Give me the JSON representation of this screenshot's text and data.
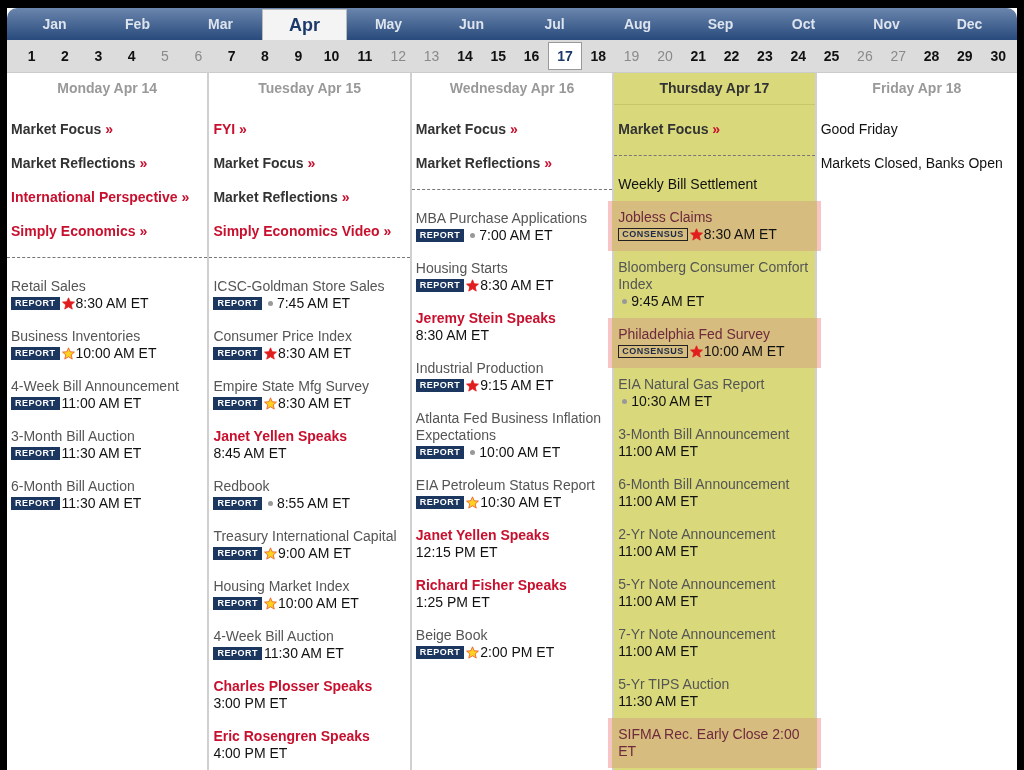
{
  "months": [
    {
      "label": "Jan",
      "selected": false
    },
    {
      "label": "Feb",
      "selected": false
    },
    {
      "label": "Mar",
      "selected": false
    },
    {
      "label": "Apr",
      "selected": true
    },
    {
      "label": "May",
      "selected": false
    },
    {
      "label": "Jun",
      "selected": false
    },
    {
      "label": "Jul",
      "selected": false
    },
    {
      "label": "Aug",
      "selected": false
    },
    {
      "label": "Sep",
      "selected": false
    },
    {
      "label": "Oct",
      "selected": false
    },
    {
      "label": "Nov",
      "selected": false
    },
    {
      "label": "Dec",
      "selected": false
    }
  ],
  "days": [
    {
      "label": "1",
      "selected": false,
      "disabled": false
    },
    {
      "label": "2",
      "selected": false,
      "disabled": false
    },
    {
      "label": "3",
      "selected": false,
      "disabled": false
    },
    {
      "label": "4",
      "selected": false,
      "disabled": false
    },
    {
      "label": "5",
      "selected": false,
      "disabled": true
    },
    {
      "label": "6",
      "selected": false,
      "disabled": true
    },
    {
      "label": "7",
      "selected": false,
      "disabled": false
    },
    {
      "label": "8",
      "selected": false,
      "disabled": false
    },
    {
      "label": "9",
      "selected": false,
      "disabled": false
    },
    {
      "label": "10",
      "selected": false,
      "disabled": false
    },
    {
      "label": "11",
      "selected": false,
      "disabled": false
    },
    {
      "label": "12",
      "selected": false,
      "disabled": true
    },
    {
      "label": "13",
      "selected": false,
      "disabled": true
    },
    {
      "label": "14",
      "selected": false,
      "disabled": false
    },
    {
      "label": "15",
      "selected": false,
      "disabled": false
    },
    {
      "label": "16",
      "selected": false,
      "disabled": false
    },
    {
      "label": "17",
      "selected": true,
      "disabled": false
    },
    {
      "label": "18",
      "selected": false,
      "disabled": false
    },
    {
      "label": "19",
      "selected": false,
      "disabled": true
    },
    {
      "label": "20",
      "selected": false,
      "disabled": true
    },
    {
      "label": "21",
      "selected": false,
      "disabled": false
    },
    {
      "label": "22",
      "selected": false,
      "disabled": false
    },
    {
      "label": "23",
      "selected": false,
      "disabled": false
    },
    {
      "label": "24",
      "selected": false,
      "disabled": false
    },
    {
      "label": "25",
      "selected": false,
      "disabled": false
    },
    {
      "label": "26",
      "selected": false,
      "disabled": true
    },
    {
      "label": "27",
      "selected": false,
      "disabled": true
    },
    {
      "label": "28",
      "selected": false,
      "disabled": false
    },
    {
      "label": "29",
      "selected": false,
      "disabled": false
    },
    {
      "label": "30",
      "selected": false,
      "disabled": false
    }
  ],
  "columns": [
    {
      "title": "Monday Apr 14",
      "selected": false,
      "links": [
        {
          "label": "Market Focus",
          "arrow": "»",
          "kind": "dark"
        },
        {
          "label": "Market Reflections",
          "arrow": "»",
          "kind": "dark"
        },
        {
          "label": "International Perspective",
          "arrow": "»",
          "kind": "red"
        },
        {
          "label": "Simply Economics",
          "arrow": "»",
          "kind": "red"
        }
      ],
      "events": [
        {
          "kind": "report",
          "title": "Retail Sales",
          "badge": {
            "text": "REPORT",
            "kind": "report"
          },
          "marker": {
            "kind": "star",
            "color": "#e21d1d"
          },
          "time": "8:30 AM ET",
          "highlight": false
        },
        {
          "kind": "report",
          "title": "Business Inventories",
          "badge": {
            "text": "REPORT",
            "kind": "report"
          },
          "marker": {
            "kind": "star",
            "color": "#ffd21f",
            "outline": true
          },
          "time": "10:00 AM ET",
          "highlight": false
        },
        {
          "kind": "report",
          "title": "4-Week Bill Announcement",
          "badge": {
            "text": "REPORT",
            "kind": "report"
          },
          "time": "11:00 AM ET",
          "highlight": false
        },
        {
          "kind": "report",
          "title": "3-Month Bill Auction",
          "badge": {
            "text": "REPORT",
            "kind": "report"
          },
          "time": "11:30 AM ET",
          "highlight": false
        },
        {
          "kind": "report",
          "title": "6-Month Bill Auction",
          "badge": {
            "text": "REPORT",
            "kind": "report"
          },
          "time": "11:30 AM ET",
          "highlight": false
        }
      ]
    },
    {
      "title": "Tuesday Apr 15",
      "selected": false,
      "links": [
        {
          "label": "FYI",
          "arrow": "»",
          "kind": "red"
        },
        {
          "label": "Market Focus",
          "arrow": "»",
          "kind": "dark"
        },
        {
          "label": "Market Reflections",
          "arrow": "»",
          "kind": "dark"
        },
        {
          "label": "Simply Economics Video",
          "arrow": "»",
          "kind": "red"
        }
      ],
      "events": [
        {
          "kind": "report",
          "title": "ICSC-Goldman Store Sales",
          "badge": {
            "text": "REPORT",
            "kind": "report"
          },
          "marker": {
            "kind": "dot",
            "color": "#999999"
          },
          "time": "7:45 AM ET",
          "highlight": false
        },
        {
          "kind": "report",
          "title": "Consumer Price Index",
          "badge": {
            "text": "REPORT",
            "kind": "report"
          },
          "marker": {
            "kind": "star",
            "color": "#e21d1d"
          },
          "time": "8:30 AM ET",
          "highlight": false
        },
        {
          "kind": "report",
          "title": "Empire State Mfg Survey",
          "badge": {
            "text": "REPORT",
            "kind": "report"
          },
          "marker": {
            "kind": "star",
            "color": "#ffd21f",
            "outline": true
          },
          "time": "8:30 AM ET",
          "highlight": false
        },
        {
          "kind": "speech",
          "title": "Janet Yellen Speaks",
          "time": "8:45 AM ET",
          "highlight": false
        },
        {
          "kind": "report",
          "title": "Redbook",
          "badge": {
            "text": "REPORT",
            "kind": "report"
          },
          "marker": {
            "kind": "dot",
            "color": "#999999"
          },
          "time": "8:55 AM ET",
          "highlight": false
        },
        {
          "kind": "report",
          "title": "Treasury International Capital",
          "badge": {
            "text": "REPORT",
            "kind": "report"
          },
          "marker": {
            "kind": "star",
            "color": "#ffd21f",
            "outline": true
          },
          "time": "9:00 AM ET",
          "highlight": false
        },
        {
          "kind": "report",
          "title": "Housing Market Index",
          "badge": {
            "text": "REPORT",
            "kind": "report"
          },
          "marker": {
            "kind": "star",
            "color": "#ffd21f",
            "outline": true
          },
          "time": "10:00 AM ET",
          "highlight": false
        },
        {
          "kind": "report",
          "title": "4-Week Bill Auction",
          "badge": {
            "text": "REPORT",
            "kind": "report"
          },
          "time": "11:30 AM ET",
          "highlight": false
        },
        {
          "kind": "speech",
          "title": "Charles Plosser Speaks",
          "time": "3:00 PM ET",
          "highlight": false
        },
        {
          "kind": "speech",
          "title": "Eric Rosengren Speaks",
          "time": "4:00 PM ET",
          "highlight": false
        }
      ]
    },
    {
      "title": "Wednesday Apr 16",
      "selected": false,
      "links": [
        {
          "label": "Market Focus",
          "arrow": "»",
          "kind": "dark"
        },
        {
          "label": "Market Reflections",
          "arrow": "»",
          "kind": "dark"
        }
      ],
      "events": [
        {
          "kind": "report",
          "title": "MBA Purchase Applications",
          "badge": {
            "text": "REPORT",
            "kind": "report"
          },
          "marker": {
            "kind": "dot",
            "color": "#999999"
          },
          "time": "7:00 AM ET",
          "highlight": false
        },
        {
          "kind": "report",
          "title": "Housing Starts",
          "badge": {
            "text": "REPORT",
            "kind": "report"
          },
          "marker": {
            "kind": "star",
            "color": "#e21d1d"
          },
          "time": "8:30 AM ET",
          "highlight": false
        },
        {
          "kind": "speech",
          "title": "Jeremy Stein Speaks",
          "time": "8:30 AM ET",
          "highlight": false
        },
        {
          "kind": "report",
          "title": "Industrial Production",
          "badge": {
            "text": "REPORT",
            "kind": "report"
          },
          "marker": {
            "kind": "star",
            "color": "#e21d1d"
          },
          "time": "9:15 AM ET",
          "highlight": false
        },
        {
          "kind": "report",
          "title": "Atlanta Fed Business Inflation Expectations",
          "badge": {
            "text": "REPORT",
            "kind": "report"
          },
          "marker": {
            "kind": "dot",
            "color": "#999999"
          },
          "time": "10:00 AM ET",
          "highlight": false
        },
        {
          "kind": "report",
          "title": "EIA Petroleum Status Report",
          "badge": {
            "text": "REPORT",
            "kind": "report"
          },
          "marker": {
            "kind": "star",
            "color": "#ffd21f",
            "outline": true
          },
          "time": "10:30 AM ET",
          "highlight": false
        },
        {
          "kind": "speech",
          "title": "Janet Yellen Speaks",
          "time": "12:15 PM ET",
          "highlight": false
        },
        {
          "kind": "speech",
          "title": "Richard Fisher Speaks",
          "time": "1:25 PM ET",
          "highlight": false
        },
        {
          "kind": "report",
          "title": "Beige Book",
          "badge": {
            "text": "REPORT",
            "kind": "report"
          },
          "marker": {
            "kind": "star",
            "color": "#ffd21f",
            "outline": true
          },
          "time": "2:00 PM ET",
          "highlight": false
        }
      ]
    },
    {
      "title": "Thursday Apr 17",
      "selected": true,
      "links": [
        {
          "label": "Market Focus",
          "arrow": "»",
          "kind": "dark"
        }
      ],
      "events": [
        {
          "kind": "plain",
          "title": "Weekly Bill Settlement",
          "highlight": false
        },
        {
          "kind": "report",
          "title": "Jobless Claims",
          "badge": {
            "text": "CONSENSUS",
            "kind": "consensus"
          },
          "marker": {
            "kind": "star",
            "color": "#e21d1d"
          },
          "time": "8:30 AM ET",
          "highlight": true
        },
        {
          "kind": "report",
          "title": "Bloomberg Consumer Comfort Index",
          "marker": {
            "kind": "dot",
            "color": "#999999"
          },
          "time": "9:45 AM ET",
          "highlight": false
        },
        {
          "kind": "report",
          "title": "Philadelphia Fed Survey",
          "badge": {
            "text": "CONSENSUS",
            "kind": "consensus"
          },
          "marker": {
            "kind": "star",
            "color": "#e21d1d"
          },
          "time": "10:00 AM ET",
          "highlight": true
        },
        {
          "kind": "report",
          "title": "EIA Natural Gas Report",
          "marker": {
            "kind": "dot",
            "color": "#999999"
          },
          "time": "10:30 AM ET",
          "highlight": false
        },
        {
          "kind": "report",
          "title": "3-Month Bill Announcement",
          "time": "11:00 AM ET",
          "highlight": false
        },
        {
          "kind": "report",
          "title": "6-Month Bill Announcement",
          "time": "11:00 AM ET",
          "highlight": false
        },
        {
          "kind": "report",
          "title": "2-Yr Note Announcement",
          "time": "11:00 AM ET",
          "highlight": false
        },
        {
          "kind": "report",
          "title": "5-Yr Note Announcement",
          "time": "11:00 AM ET",
          "highlight": false
        },
        {
          "kind": "report",
          "title": "7-Yr Note Announcement",
          "time": "11:00 AM ET",
          "highlight": false
        },
        {
          "kind": "report",
          "title": "5-Yr TIPS Auction",
          "time": "11:30 AM ET",
          "highlight": false
        },
        {
          "kind": "plain",
          "title": "SIFMA Rec. Early Close 2:00 ET",
          "highlight": true
        }
      ]
    },
    {
      "title": "Friday Apr 18",
      "selected": false,
      "links": [
        {
          "label": "Good Friday",
          "kind": "plain"
        },
        {
          "label": "Markets Closed, Banks Open",
          "kind": "plain"
        }
      ]
    }
  ]
}
